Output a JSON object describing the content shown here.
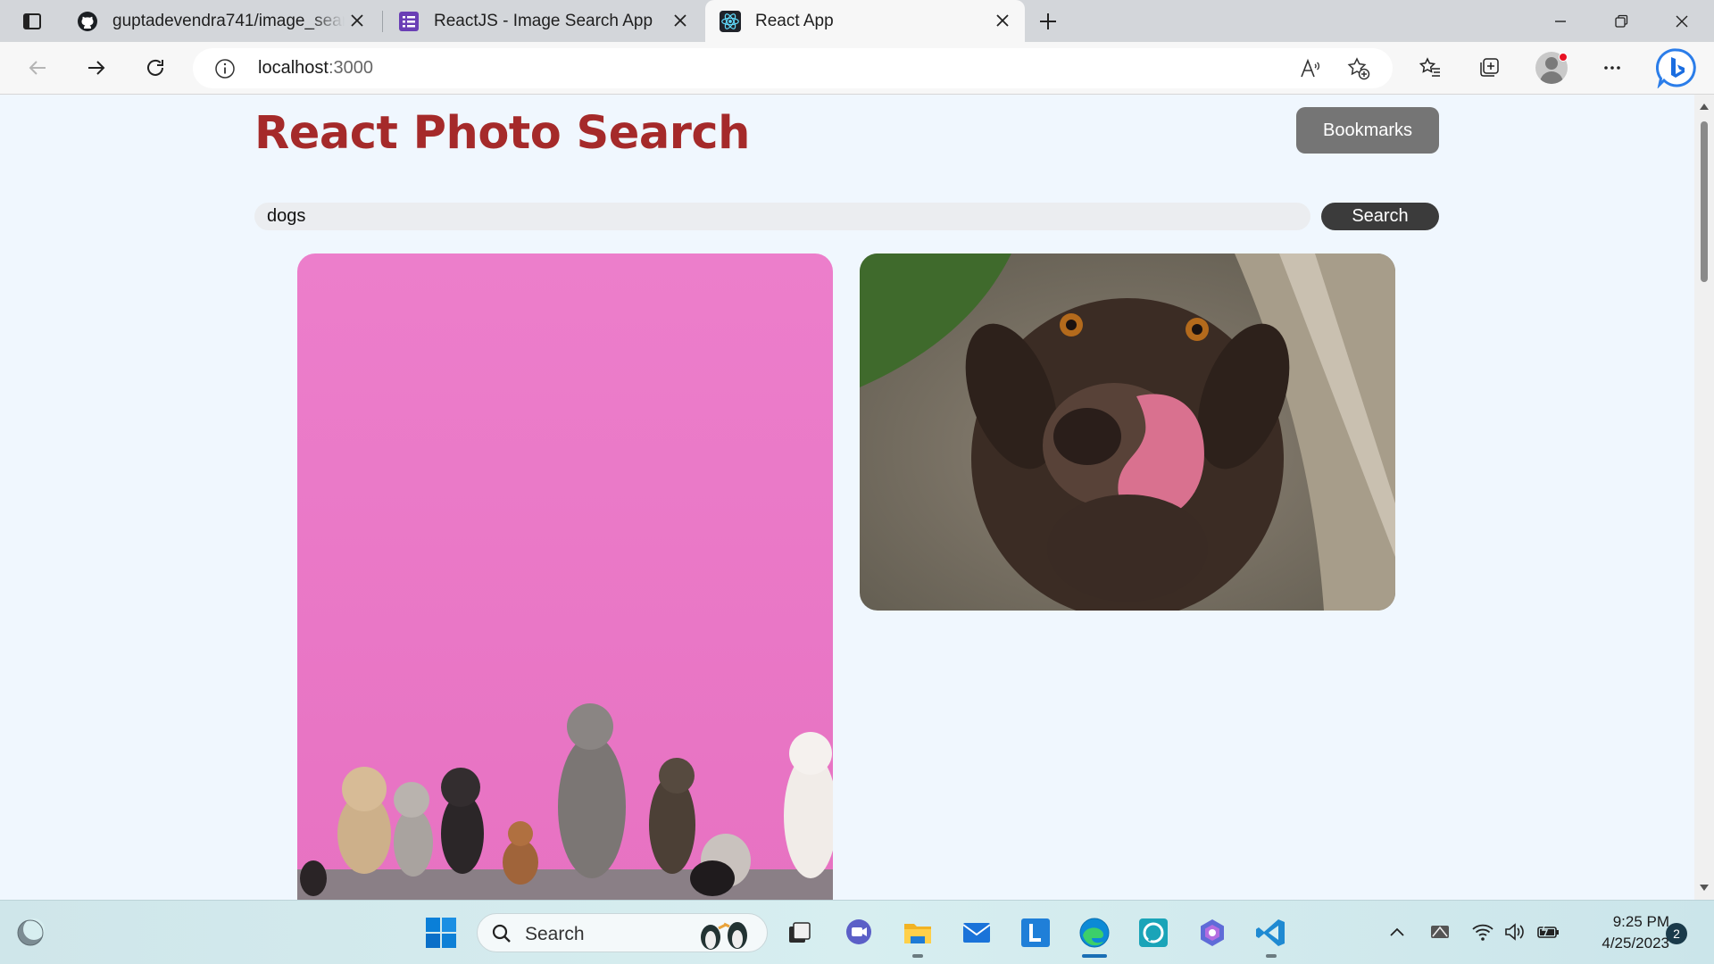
{
  "browser": {
    "tabs": [
      {
        "title": "guptadevendra741/image_search",
        "favicon": "github-icon"
      },
      {
        "title": "ReactJS - Image Search App",
        "favicon": "purple-doc-icon"
      },
      {
        "title": "React App",
        "favicon": "react-icon",
        "active": true
      }
    ],
    "address": {
      "host": "localhost",
      "port": ":3000"
    }
  },
  "page": {
    "title": "React Photo Search",
    "bookmarks_label": "Bookmarks",
    "search_value": "dogs",
    "search_button_label": "Search",
    "photos": [
      {
        "alt": "Row of dogs sitting against a pink wall"
      },
      {
        "alt": "Brown dog licking its nose"
      }
    ]
  },
  "taskbar": {
    "search_label": "Search",
    "time": "9:25 PM",
    "date": "4/25/2023",
    "notification_count": "2"
  },
  "colors": {
    "title": "#a52a2a",
    "page_background": "#f0f7fe",
    "bookmarks_button": "#757575",
    "search_button": "#3b3b3b"
  }
}
